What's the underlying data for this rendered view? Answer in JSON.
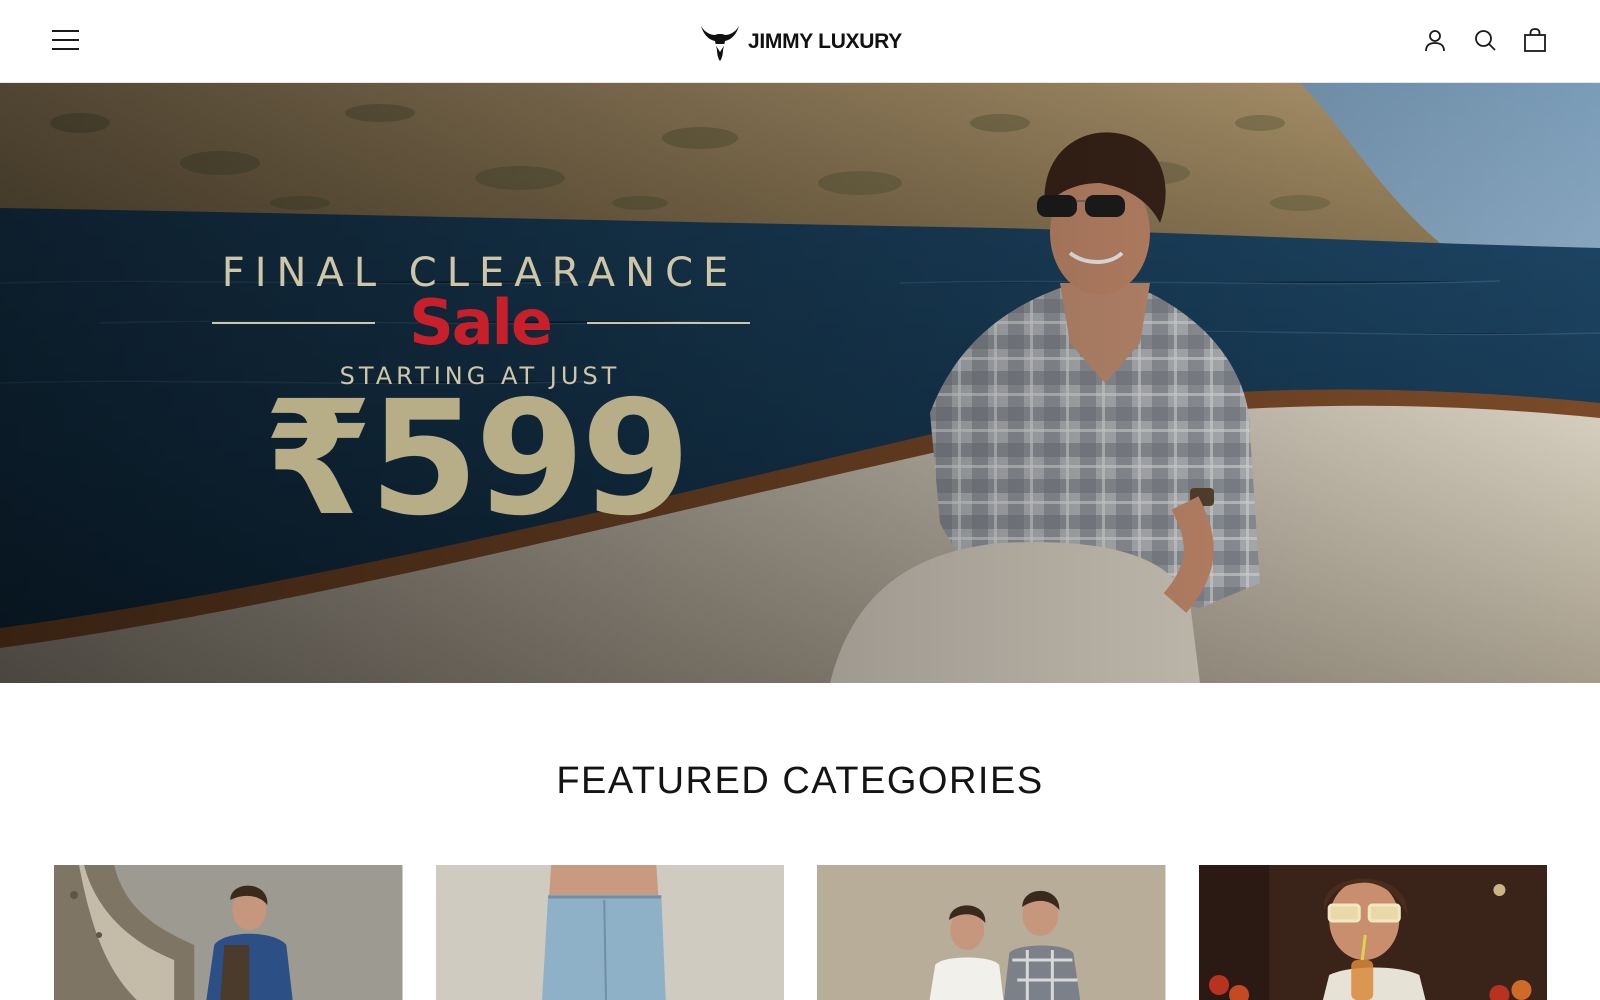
{
  "header": {
    "brand": "JIMMY LUXURY",
    "icons": [
      "menu-icon",
      "account-icon",
      "search-icon",
      "cart-icon"
    ]
  },
  "hero": {
    "line1": "FINAL CLEARANCE",
    "sale": "Sale",
    "line3": "STARTING AT JUST",
    "price": "₹599",
    "colors": {
      "text": "#cfc6a8",
      "sale": "#c8202a",
      "price": "#b7ad86"
    }
  },
  "featured": {
    "title": "FEATURED CATEGORIES"
  }
}
